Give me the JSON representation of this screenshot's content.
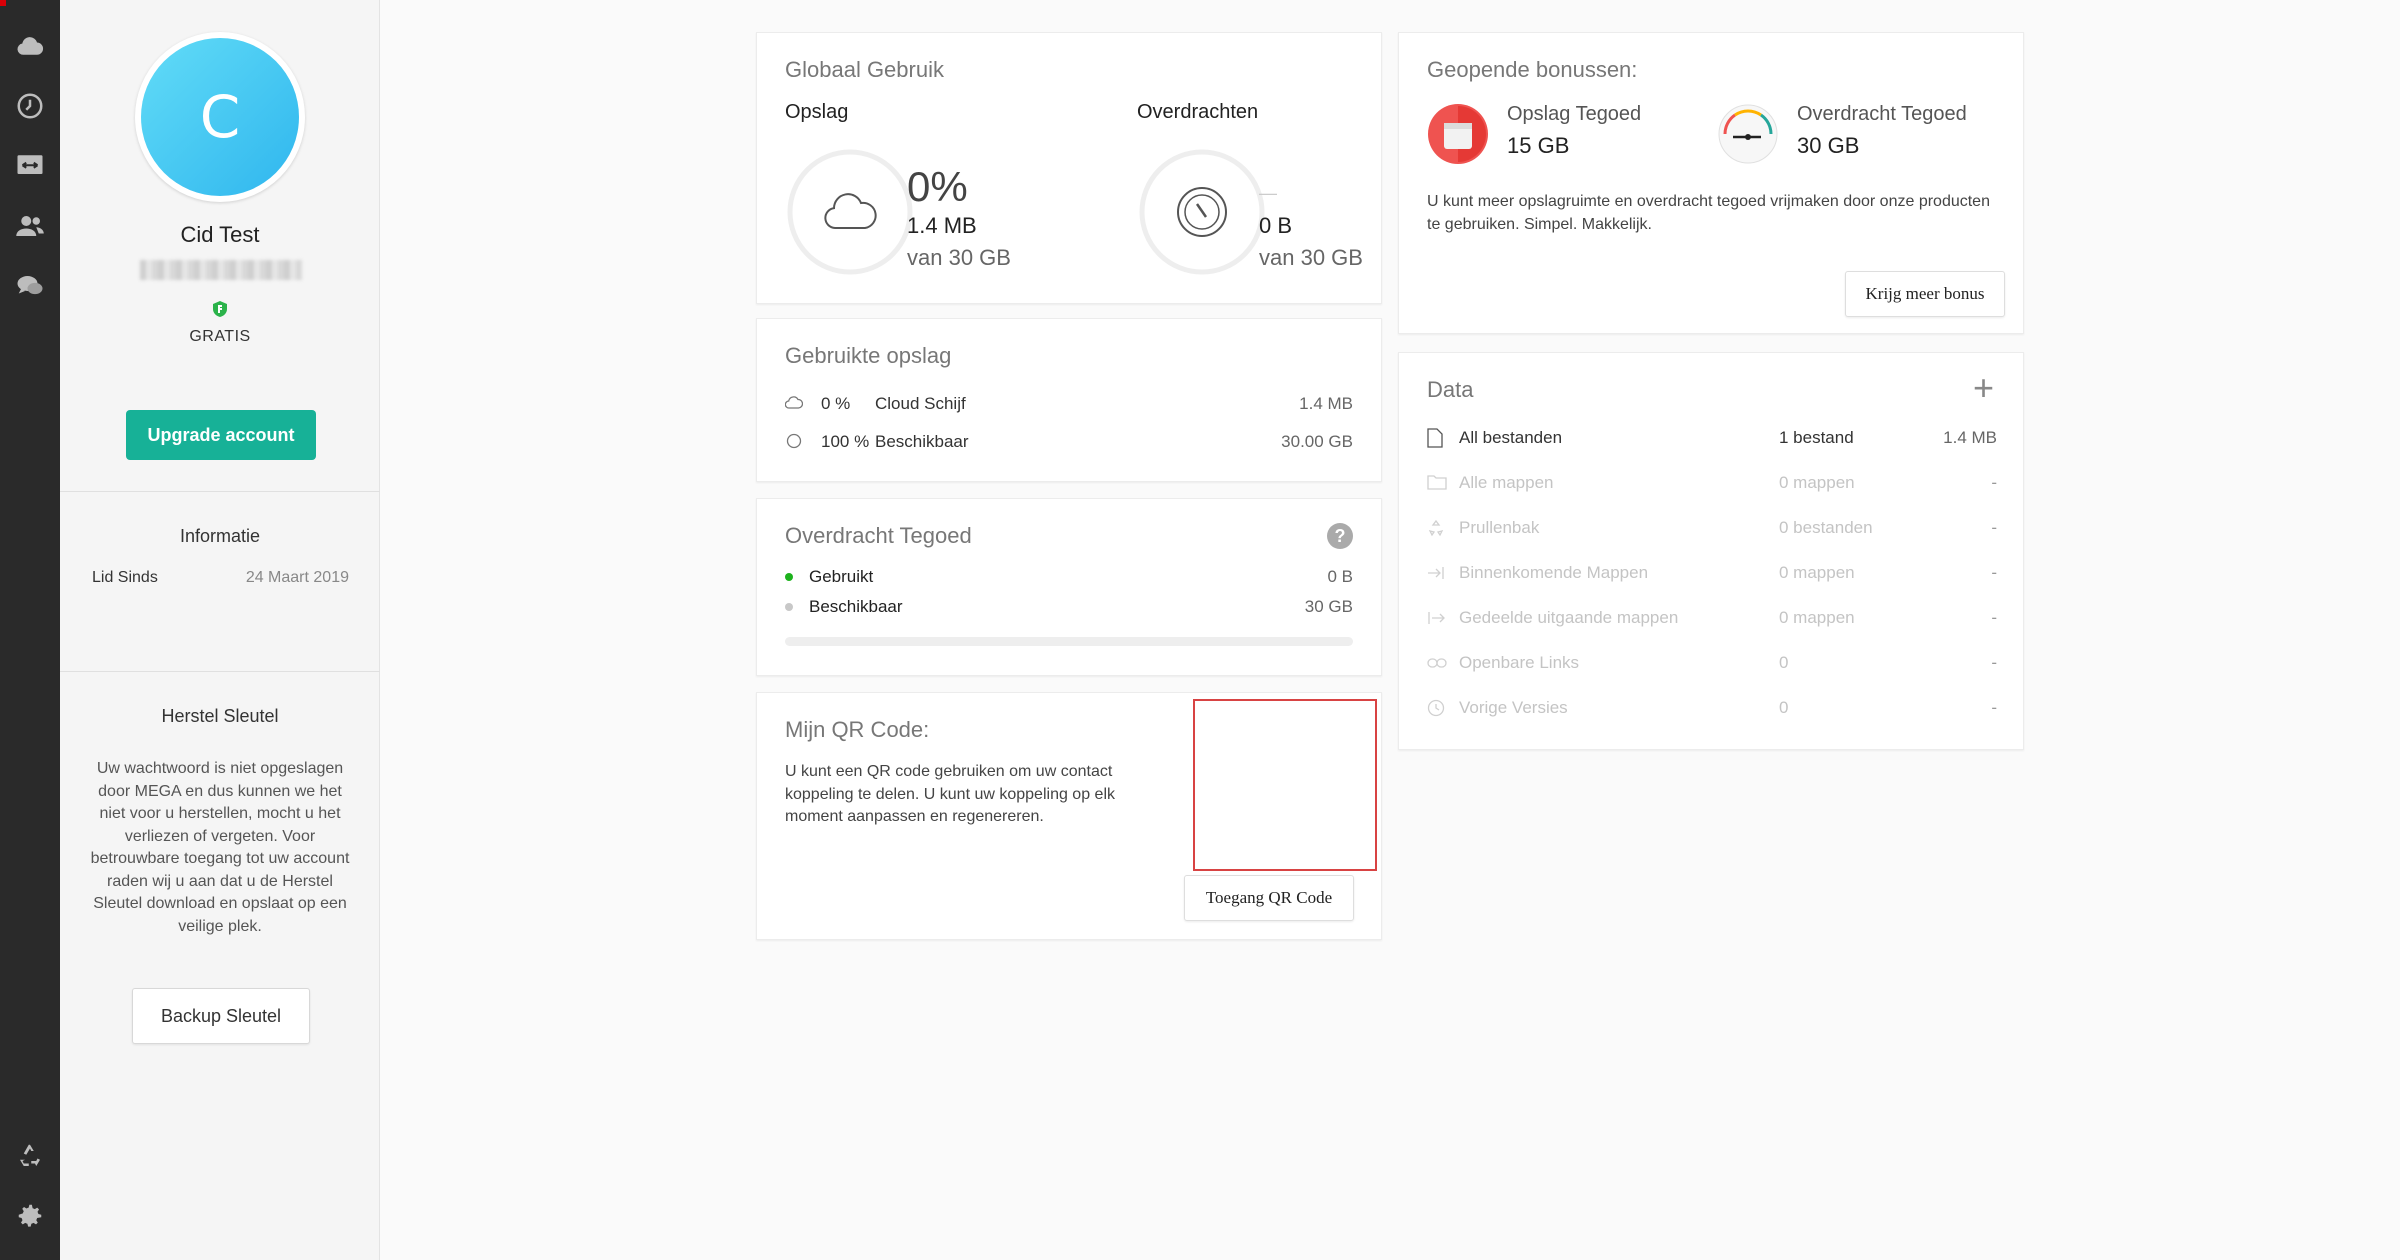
{
  "rail": {
    "items": [
      "cloud-drive",
      "recents",
      "transfers",
      "contacts",
      "chat"
    ],
    "bottom_items": [
      "rubbish-bin",
      "settings"
    ]
  },
  "profile": {
    "avatar_letter": "C",
    "name": "Cid Test",
    "plan": "GRATIS",
    "upgrade_label": "Upgrade account",
    "info_title": "Informatie",
    "member_since_label": "Lid Sinds",
    "member_since_value": "24 Maart 2019",
    "recovery_title": "Herstel Sleutel",
    "recovery_text": "Uw wachtwoord is niet opgeslagen door MEGA en dus kunnen we het niet voor u herstellen, mocht u het verliezen of vergeten. Voor betrouwbare toegang tot uw account raden wij u aan dat u de Herstel Sleutel download en opslaat op een veilige plek.",
    "backup_label": "Backup Sleutel"
  },
  "global_usage": {
    "title": "Globaal Gebruik",
    "storage": {
      "label": "Opslag",
      "percent": "0%",
      "used": "1.4 MB",
      "total": "van 30 GB"
    },
    "transfer": {
      "label": "Overdrachten",
      "dash": "—",
      "used": "0 B",
      "total": "van 30 GB"
    }
  },
  "used_storage": {
    "title": "Gebruikte opslag",
    "rows": [
      {
        "pct": "0 %",
        "label": "Cloud Schijf",
        "value": "1.4 MB"
      },
      {
        "pct": "100 %",
        "label": "Beschikbaar",
        "value": "30.00 GB"
      }
    ]
  },
  "transfer_quota": {
    "title": "Overdracht Tegoed",
    "help": "?",
    "used_label": "Gebruikt",
    "used_value": "0 B",
    "avail_label": "Beschikbaar",
    "avail_value": "30 GB",
    "used_fraction": 0,
    "used_color": "#1db21d"
  },
  "qr": {
    "title": "Mijn QR Code:",
    "text": "U kunt een QR code gebruiken om uw contact koppeling te delen. U kunt uw koppeling op elk moment aanpassen en regenereren.",
    "button": "Toegang QR Code"
  },
  "bonuses": {
    "title": "Geopende bonussen:",
    "storage_label": "Opslag Tegoed",
    "storage_value": "15 GB",
    "transfer_label": "Overdracht Tegoed",
    "transfer_value": "30 GB",
    "text": "U kunt meer opslagruimte en overdracht tegoed vrijmaken door onze producten te gebruiken. Simpel. Makkelijk.",
    "button": "Krijg meer bonus"
  },
  "data": {
    "title": "Data",
    "add": "+",
    "rows": [
      {
        "icon": "file-icon",
        "label": "All bestanden",
        "count": "1 bestand",
        "size": "1.4 MB",
        "active": true
      },
      {
        "icon": "folder-icon",
        "label": "Alle mappen",
        "count": "0 mappen",
        "size": "-",
        "active": false
      },
      {
        "icon": "rubbish-icon",
        "label": "Prullenbak",
        "count": "0 bestanden",
        "size": "-",
        "active": false
      },
      {
        "icon": "incoming-icon",
        "label": "Binnenkomende Mappen",
        "count": "0 mappen",
        "size": "-",
        "active": false
      },
      {
        "icon": "outgoing-icon",
        "label": "Gedeelde uitgaande mappen",
        "count": "0 mappen",
        "size": "-",
        "active": false
      },
      {
        "icon": "link-icon",
        "label": "Openbare Links",
        "count": "0",
        "size": "-",
        "active": false
      },
      {
        "icon": "versions-icon",
        "label": "Vorige Versies",
        "count": "0",
        "size": "-",
        "active": false
      }
    ]
  },
  "colors": {
    "accent": "#17b197",
    "avatar": "#3fc4f2",
    "rail": "#2a2a2a",
    "brand_red": "#d90007"
  }
}
